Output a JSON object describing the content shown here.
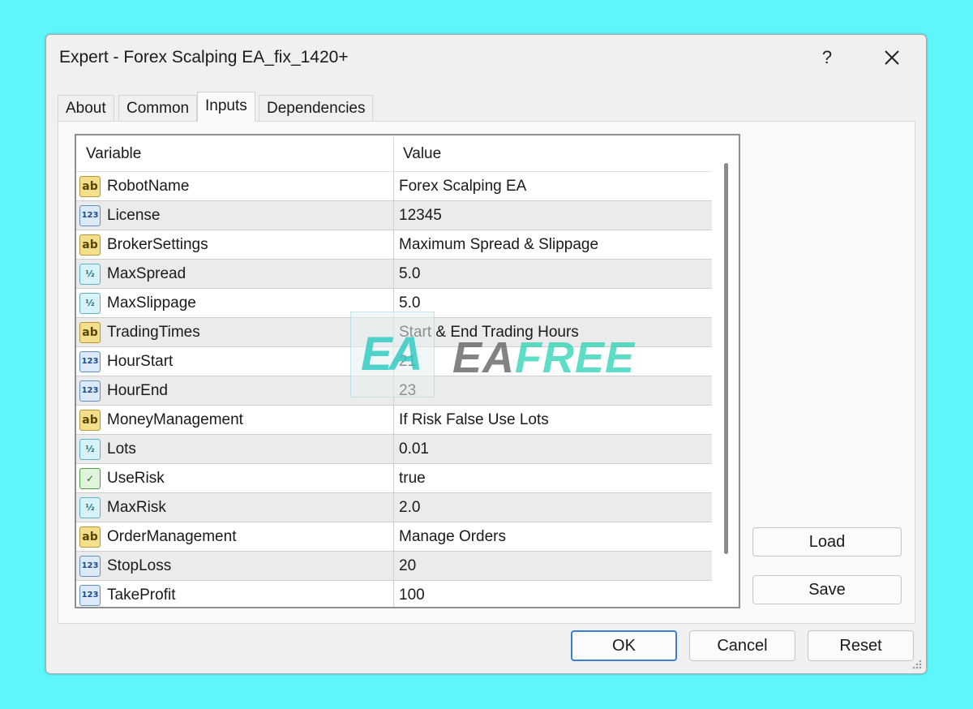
{
  "window": {
    "title": "Expert - Forex Scalping EA_fix_1420+",
    "help_label": "?",
    "close_label": "close"
  },
  "tabs": [
    {
      "label": "About",
      "active": false
    },
    {
      "label": "Common",
      "active": false
    },
    {
      "label": "Inputs",
      "active": true
    },
    {
      "label": "Dependencies",
      "active": false
    }
  ],
  "table": {
    "headers": {
      "variable": "Variable",
      "value": "Value"
    },
    "rows": [
      {
        "icon": "ab",
        "icon_text": "ab",
        "name": "RobotName",
        "value": "Forex Scalping EA"
      },
      {
        "icon": "num",
        "icon_text": "123",
        "name": "License",
        "value": "12345"
      },
      {
        "icon": "ab",
        "icon_text": "ab",
        "name": "BrokerSettings",
        "value": "Maximum Spread & Slippage"
      },
      {
        "icon": "frac",
        "icon_text": "½",
        "name": "MaxSpread",
        "value": "5.0"
      },
      {
        "icon": "frac",
        "icon_text": "½",
        "name": "MaxSlippage",
        "value": "5.0"
      },
      {
        "icon": "ab",
        "icon_text": "ab",
        "name": "TradingTimes",
        "value": "Start & End Trading Hours"
      },
      {
        "icon": "num",
        "icon_text": "123",
        "name": "HourStart",
        "value": "21"
      },
      {
        "icon": "num",
        "icon_text": "123",
        "name": "HourEnd",
        "value": "23"
      },
      {
        "icon": "ab",
        "icon_text": "ab",
        "name": "MoneyManagement",
        "value": "If Risk False Use Lots"
      },
      {
        "icon": "frac",
        "icon_text": "½",
        "name": "Lots",
        "value": "0.01"
      },
      {
        "icon": "bool",
        "icon_text": "✓",
        "name": "UseRisk",
        "value": "true"
      },
      {
        "icon": "frac",
        "icon_text": "½",
        "name": "MaxRisk",
        "value": "2.0"
      },
      {
        "icon": "ab",
        "icon_text": "ab",
        "name": "OrderManagement",
        "value": "Manage Orders"
      },
      {
        "icon": "num",
        "icon_text": "123",
        "name": "StopLoss",
        "value": "20"
      },
      {
        "icon": "num",
        "icon_text": "123",
        "name": "TakeProfit",
        "value": "100"
      }
    ]
  },
  "side_buttons": {
    "load": "Load",
    "save": "Save"
  },
  "footer_buttons": {
    "ok": "OK",
    "cancel": "Cancel",
    "reset": "Reset"
  },
  "watermark": {
    "logo": "EA",
    "brand_part1": "EA",
    "brand_part2": "FREE"
  },
  "colors": {
    "background": "#5ff6fb",
    "dialog": "#f0f0f0",
    "row_alt": "#ebebeb",
    "ok_border": "#3b7fd3"
  }
}
